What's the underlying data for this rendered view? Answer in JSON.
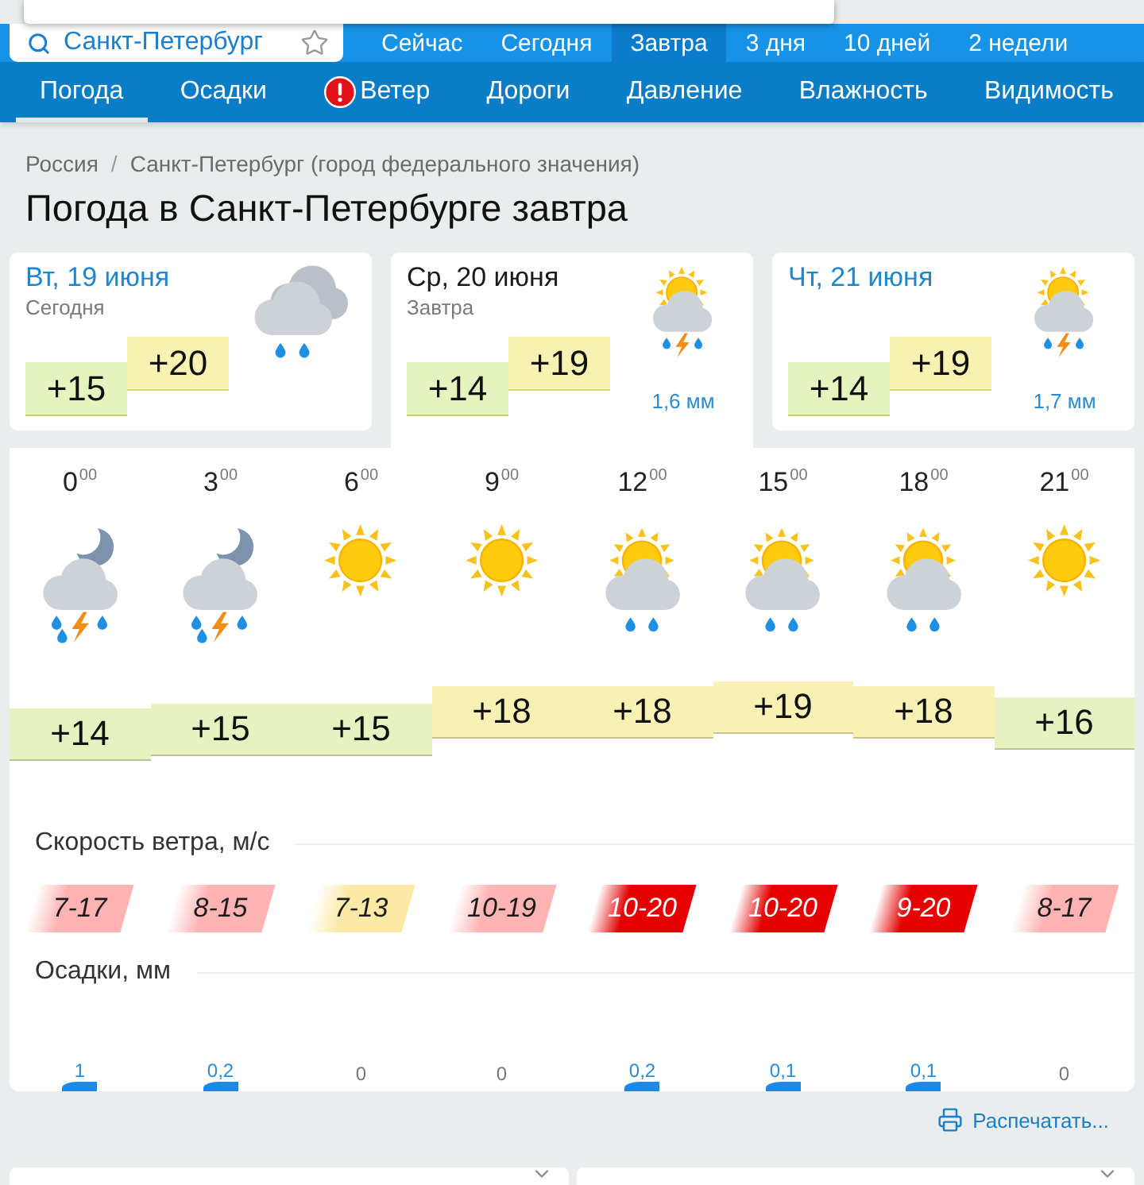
{
  "search": {
    "value": "Санкт-Петербург"
  },
  "period_tabs": [
    {
      "label": "Сейчас",
      "selected": false
    },
    {
      "label": "Сегодня",
      "selected": false
    },
    {
      "label": "Завтра",
      "selected": true
    },
    {
      "label": "3 дня",
      "selected": false
    },
    {
      "label": "10 дней",
      "selected": false
    },
    {
      "label": "2 недели",
      "selected": false
    }
  ],
  "nav_tabs": [
    {
      "label": "Погода",
      "selected": true,
      "alert": false
    },
    {
      "label": "Осадки",
      "selected": false,
      "alert": false
    },
    {
      "label": "Ветер",
      "selected": false,
      "alert": true
    },
    {
      "label": "Дороги",
      "selected": false,
      "alert": false
    },
    {
      "label": "Давление",
      "selected": false,
      "alert": false
    },
    {
      "label": "Влажность",
      "selected": false,
      "alert": false
    },
    {
      "label": "Видимость",
      "selected": false,
      "alert": false
    }
  ],
  "breadcrumb": {
    "items": [
      "Россия",
      "Санкт-Петербург (город федерального значения)"
    ],
    "separator": "/"
  },
  "title": "Погода в Санкт-Петербурге завтра",
  "days": [
    {
      "date": "Вт, 19 июня",
      "label": "Сегодня",
      "kind": "rain",
      "min": "+15",
      "max": "+20",
      "selected": false
    },
    {
      "date": "Ср, 20 июня",
      "label": "Завтра",
      "kind": "thunder",
      "min": "+14",
      "max": "+19",
      "precip": "1,6 мм",
      "selected": true
    },
    {
      "date": "Чт, 21 июня",
      "kind": "thunder",
      "min": "+14",
      "max": "+19",
      "precip": "1,7 мм",
      "selected": false
    }
  ],
  "hours": [
    {
      "time": "0$^{00}$",
      "kind": "nightstorm",
      "temp": "+14",
      "color": "#e6f3c0"
    },
    {
      "time": "3$^{00}$",
      "kind": "nightstorm",
      "temp": "+15",
      "color": "#e6f3c0"
    },
    {
      "time": "6$^{00}$",
      "kind": "sunny",
      "temp": "+15",
      "color": "#e6f3c0"
    },
    {
      "time": "9$^{00}$",
      "kind": "sunny",
      "temp": "+18",
      "color": "#f8f1b3"
    },
    {
      "time": "12$^{00}$",
      "kind": "showers",
      "temp": "+18",
      "color": "#f8f1b3"
    },
    {
      "time": "15$^{00}$",
      "kind": "showers",
      "temp": "+19",
      "color": "#f8f1b3"
    },
    {
      "time": "18$^{00}$",
      "kind": "showers",
      "temp": "+18",
      "color": "#f8f1b3"
    },
    {
      "time": "21$^{00}$",
      "kind": "sunny",
      "temp": "+16",
      "color": "#e6f3c0"
    }
  ],
  "wind": {
    "title": "Скорость ветра, м/с",
    "values": [
      {
        "text": "7-17",
        "color": "#ffb3b3"
      },
      {
        "text": "8-15",
        "color": "#ffb3b3"
      },
      {
        "text": "7-13",
        "color": "#fde9a6"
      },
      {
        "text": "10-19",
        "color": "#ffb3b3"
      },
      {
        "text": "10-20",
        "color": "#e50000"
      },
      {
        "text": "10-20",
        "color": "#e50000"
      },
      {
        "text": "9-20",
        "color": "#e50000"
      },
      {
        "text": "8-17",
        "color": "#ffb3b3"
      }
    ]
  },
  "precipitation": {
    "title": "Осадки, мм",
    "values": [
      {
        "text": "1",
        "kind": "rain"
      },
      {
        "text": "0,2",
        "kind": "rain"
      },
      {
        "text": "0",
        "kind": "none"
      },
      {
        "text": "0",
        "kind": "none"
      },
      {
        "text": "0,2",
        "kind": "rain"
      },
      {
        "text": "0,1",
        "kind": "rain"
      },
      {
        "text": "0,1",
        "kind": "rain"
      },
      {
        "text": "0",
        "kind": "none"
      }
    ]
  },
  "print_link": "Распечатать..."
}
